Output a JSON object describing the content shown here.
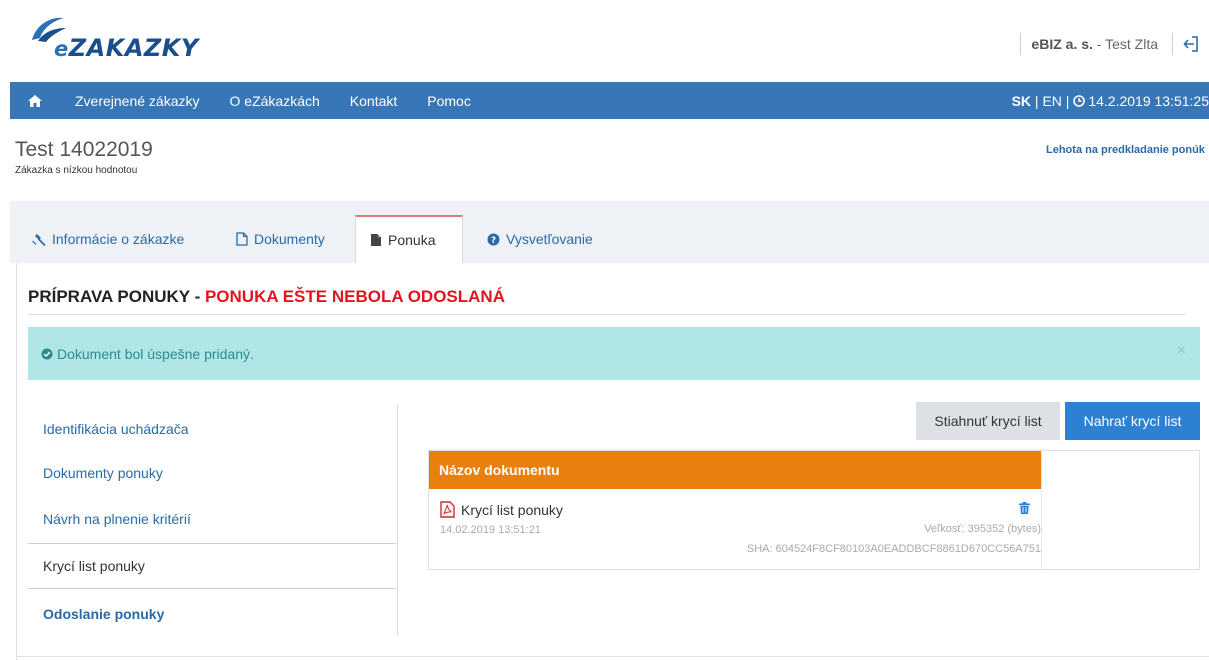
{
  "header": {
    "logo_text": "ZAKAZKY",
    "logo_prefix": "e",
    "user_company": "eBIZ a. s.",
    "user_separator": " - ",
    "user_name": "Test Zlta",
    "logout_icon": "logout-icon"
  },
  "nav": {
    "home_icon": "home-icon",
    "items": [
      "Zverejnené zákazky",
      "O eZákazkách",
      "Kontakt",
      "Pomoc"
    ],
    "lang_sk": "SK",
    "lang_sep": " | ",
    "lang_en": "EN",
    "sep2": " | ",
    "datetime": "14.2.2019 13:51:25",
    "clock_icon": "clock-icon"
  },
  "page": {
    "title": "Test 14022019",
    "subtitle": "Zákazka s nízkou hodnotou",
    "deadline_label": "Lehota na predkladanie ponúk"
  },
  "tabs": [
    {
      "label": "Informácie o zákazke",
      "icon": "gavel-icon"
    },
    {
      "label": "Dokumenty",
      "icon": "file-icon"
    },
    {
      "label": "Ponuka",
      "icon": "file-filled-icon"
    },
    {
      "label": "Vysvetľovanie",
      "icon": "question-circle-icon"
    }
  ],
  "section": {
    "title_main": "PRÍPRAVA PONUKY - ",
    "title_status": "PONUKA EŠTE NEBOLA ODOSLANÁ"
  },
  "alert": {
    "text": "Dokument bol úspešne pridaný.",
    "close": "×"
  },
  "side_menu": [
    {
      "label": "Identifikácia uchádzača"
    },
    {
      "label": "Dokumenty ponuky"
    },
    {
      "label": "Návrh na plnenie kritérií"
    },
    {
      "label": "Krycí list ponuky"
    },
    {
      "label": "Odoslanie ponuky"
    }
  ],
  "buttons": {
    "download": "Stiahnuť krycí list",
    "upload": "Nahrať krycí list"
  },
  "document_table": {
    "header": "Názov dokumentu",
    "row": {
      "name": "Krycí list ponuky",
      "date": "14.02.2019 13:51:21",
      "size": "Veľkosť: 395352 (bytes)",
      "sha": "SHA: 604524F8CF80103A0EADDBCF8861D670CC56A751"
    }
  },
  "colors": {
    "nav": "#3777b8",
    "accent_red": "#e2141c",
    "table_header": "#e9800e",
    "alert_bg": "#b1e6e6",
    "primary_button": "#2d80d2"
  }
}
